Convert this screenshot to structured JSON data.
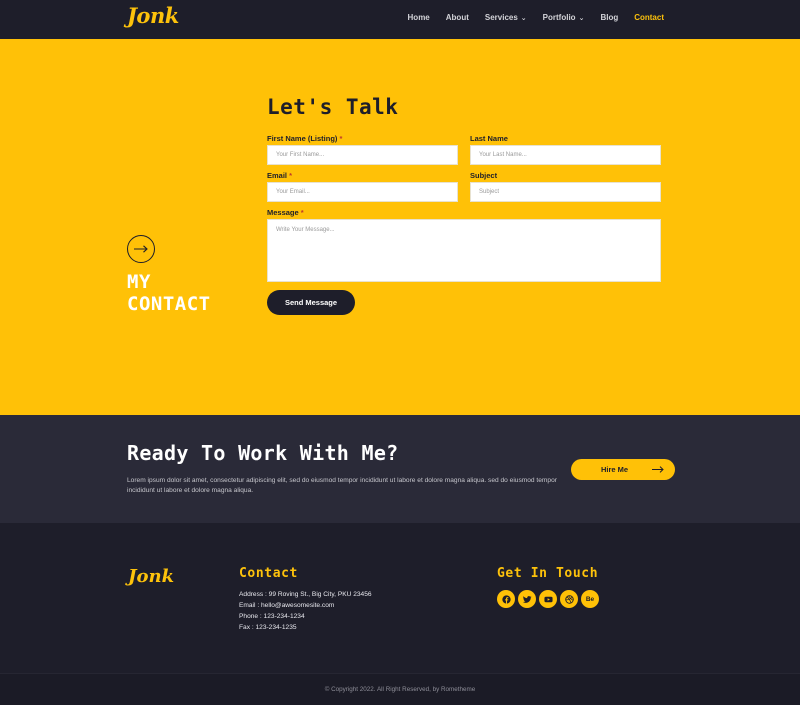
{
  "nav": {
    "logo": "Jonk",
    "items": [
      {
        "label": "Home",
        "dropdown": false,
        "active": false
      },
      {
        "label": "About",
        "dropdown": false,
        "active": false
      },
      {
        "label": "Services",
        "dropdown": true,
        "active": false
      },
      {
        "label": "Portfolio",
        "dropdown": true,
        "active": false
      },
      {
        "label": "Blog",
        "dropdown": false,
        "active": false
      },
      {
        "label": "Contact",
        "dropdown": false,
        "active": true
      }
    ]
  },
  "hero": {
    "side_title_line1": "MY",
    "side_title_line2": "CONTACT",
    "form_title": "Let's Talk",
    "fields": {
      "first_name": {
        "label": "First Name (Listing)",
        "required": "*",
        "placeholder": "Your First Name..."
      },
      "last_name": {
        "label": "Last Name",
        "placeholder": "Your Last Name..."
      },
      "email": {
        "label": "Email",
        "required": "*",
        "placeholder": "Your Email..."
      },
      "subject": {
        "label": "Subject",
        "placeholder": "Subject"
      },
      "message": {
        "label": "Message",
        "required": "*",
        "placeholder": "Write Your Message..."
      }
    },
    "submit_label": "Send Message"
  },
  "cta": {
    "title": "Ready To Work With Me?",
    "text": "Lorem ipsum dolor sit amet, consectetur adipiscing elit, sed do eiusmod tempor incididunt ut labore et dolore magna aliqua. sed do eiusmod tempor incididunt ut labore et dolore magna aliqua.",
    "button_label": "Hire Me"
  },
  "footer": {
    "logo": "Jonk",
    "contact_heading": "Contact",
    "address": "Address : 99 Roving St., Big City, PKU 23456",
    "email": "Email : hello@awesomesite.com",
    "phone": "Phone : 123-234-1234",
    "fax": "Fax : 123-234-1235",
    "social_heading": "Get In Touch",
    "socials": [
      "facebook-icon",
      "twitter-icon",
      "youtube-icon",
      "dribbble-icon",
      "behance-icon"
    ],
    "behance_text": "Be",
    "copyright": "© Copyright 2022. All Right Reserved, by Rometheme"
  },
  "colors": {
    "accent": "#ffc107",
    "dark": "#1e1e2a",
    "cta_bg": "#2a2a38"
  }
}
